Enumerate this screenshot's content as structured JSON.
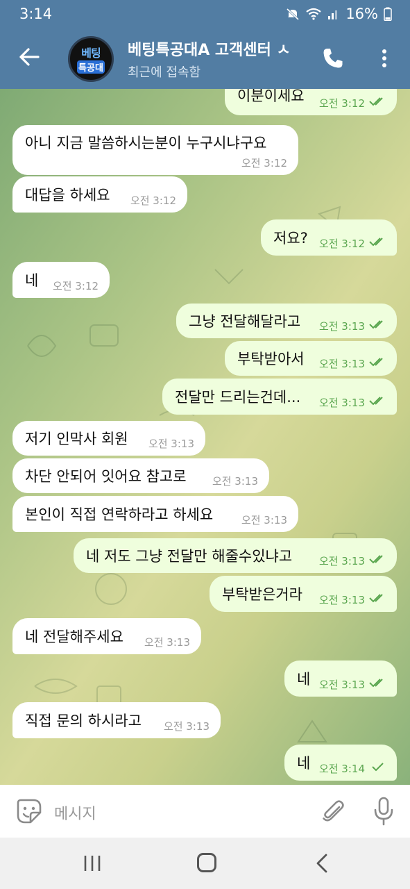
{
  "status": {
    "time": "3:14",
    "battery": "16%"
  },
  "header": {
    "title": "베팅특공대A 고객센터 ㅅ",
    "subtitle": "최근에 접속함",
    "avatar_top": "베팅",
    "avatar_bottom": "특공대"
  },
  "messages": [
    {
      "dir": "out",
      "text": "이분이세요",
      "time": "오전 3:12",
      "status": "read"
    },
    {
      "dir": "in",
      "text": "아니 지금 말씀하시는분이 누구시냐구요",
      "time": "오전 3:12"
    },
    {
      "dir": "in",
      "text": "대답을 하세요",
      "time": "오전 3:12"
    },
    {
      "dir": "out",
      "text": "저요?",
      "time": "오전 3:12",
      "status": "read"
    },
    {
      "dir": "in",
      "text": "네",
      "time": "오전 3:12"
    },
    {
      "dir": "out",
      "text": "그냥 전달해달라고",
      "time": "오전 3:13",
      "status": "read"
    },
    {
      "dir": "out",
      "text": "부탁받아서",
      "time": "오전 3:13",
      "status": "read"
    },
    {
      "dir": "out",
      "text": "전달만 드리는건데...",
      "time": "오전 3:13",
      "status": "read"
    },
    {
      "dir": "in",
      "text": "저기 인막사 회원",
      "time": "오전 3:13"
    },
    {
      "dir": "in",
      "text": "차단 안되어 잇어요 참고로",
      "time": "오전 3:13"
    },
    {
      "dir": "in",
      "text": "본인이 직접 연락하라고 하세요",
      "time": "오전 3:13"
    },
    {
      "dir": "out",
      "text": "네 저도 그냥 전달만 해줄수있냐고",
      "time": "오전 3:13",
      "status": "read"
    },
    {
      "dir": "out",
      "text": "부탁받은거라",
      "time": "오전 3:13",
      "status": "read"
    },
    {
      "dir": "in",
      "text": "네 전달해주세요",
      "time": "오전 3:13"
    },
    {
      "dir": "out",
      "text": "네",
      "time": "오전 3:13",
      "status": "read"
    },
    {
      "dir": "in",
      "text": "직접 문의 하시라고",
      "time": "오전 3:13"
    },
    {
      "dir": "out",
      "text": "네",
      "time": "오전 3:14",
      "status": "sent"
    }
  ],
  "input": {
    "placeholder": "메시지"
  },
  "colors": {
    "header": "#527da3",
    "out_bubble": "#effedd",
    "in_bubble": "#ffffff",
    "check": "#5aa64f"
  }
}
